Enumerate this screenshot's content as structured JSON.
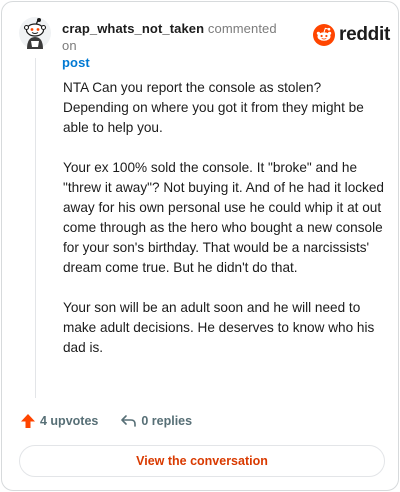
{
  "comment": {
    "author": "crap_whats_not_taken",
    "action": "commented on",
    "target": "post",
    "paragraphs": [
      "NTA Can you report the console as stolen? Depending on where you got it from they might be able to help you.",
      "Your ex 100% sold the console. It \"broke\" and he \"threw it away\"? Not buying it. And of he had it locked away for his own personal use he could whip it at out come through as the hero who bought a new console for your son's birthday. That would be a narcissists' dream come true. But he didn't do that.",
      "Your son will be an adult soon and he will need to make adult decisions. He deserves to know who his dad is."
    ]
  },
  "brand": {
    "name": "reddit",
    "icon": "reddit-logo",
    "color": "#ff4500"
  },
  "actions": {
    "upvotes_label": "4 upvotes",
    "replies_label": "0 replies",
    "upvote_icon": "upvote-arrow-icon",
    "reply_icon": "reply-arrow-icon",
    "upvote_color": "#ff4500"
  },
  "cta": {
    "label": "View the conversation",
    "color": "#d93a00"
  }
}
